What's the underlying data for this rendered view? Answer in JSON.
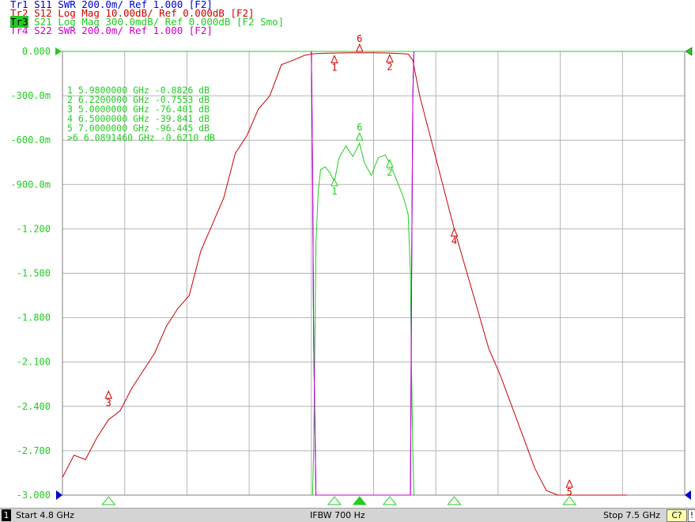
{
  "traces": [
    {
      "id": "tr1",
      "name": "Tr1",
      "param": "S11",
      "format": "SWR",
      "scale": "200.0m/",
      "ref": "Ref 1.000",
      "extra": "[F2]",
      "text": "S11 SWR 200.0m/ Ref 1.000 [F2]",
      "color": "#0000cc"
    },
    {
      "id": "tr2",
      "name": "Tr2",
      "param": "S12",
      "format": "Log Mag",
      "scale": "10.00dB/",
      "ref": "Ref 0.000dB",
      "extra": "[F2]",
      "text": "S12 Log Mag 10.00dB/ Ref 0.000dB [F2]",
      "color": "#cc0000"
    },
    {
      "id": "tr3",
      "name": "Tr3",
      "param": "S21",
      "format": "Log Mag",
      "scale": "300.0mdB/",
      "ref": "Ref 0.000dB",
      "extra": "[F2 Smo]",
      "text": "S21 Log Mag 300.0mdB/ Ref 0.000dB [F2 Smo]",
      "color": "#22cc22",
      "active": true
    },
    {
      "id": "tr4",
      "name": "Tr4",
      "param": "S22",
      "format": "SWR",
      "scale": "200.0m/",
      "ref": "Ref 1.000",
      "extra": "[F2]",
      "text": "S22 SWR 200.0m/ Ref 1.000 [F2]",
      "color": "#cc00cc"
    }
  ],
  "colors": {
    "tr1": "#0000cc",
    "tr2": "#cc0000",
    "tr3": "#22cc22",
    "tr4": "#cc00cc",
    "grid": "#b4b4b4",
    "ref_marker": "#22cc22"
  },
  "y_ticks": [
    "0.000",
    "-300.0m",
    "-600.0m",
    "-900.0m",
    "-1.200",
    "-1.500",
    "-1.800",
    "-2.100",
    "-2.400",
    "-2.700",
    "-3.000"
  ],
  "marker_table": [
    {
      "id": "1",
      "prefix": " ",
      "freq": "5.9800000 GHz",
      "value": "-0.8826 dB"
    },
    {
      "id": "2",
      "prefix": " ",
      "freq": "6.2200000 GHz",
      "value": "-0.7553 dB"
    },
    {
      "id": "3",
      "prefix": " ",
      "freq": "5.0000000 GHz",
      "value": "-76.401 dB"
    },
    {
      "id": "4",
      "prefix": " ",
      "freq": "6.5000000 GHz",
      "value": "-39.841 dB"
    },
    {
      "id": "5",
      "prefix": " ",
      "freq": "7.0000000 GHz",
      "value": "-96.445 dB"
    },
    {
      "id": "6",
      "prefix": ">",
      "freq": "6.0891460 GHz",
      "value": "-0.6210 dB"
    }
  ],
  "status": {
    "channel": "1",
    "start": "Start 4.8 GHz",
    "ifbw": "IFBW 700 Hz",
    "stop": "Stop 7.5 GHz",
    "cal": "C?",
    "warn": "!"
  },
  "chart_data": {
    "type": "line",
    "x_unit": "GHz",
    "xlim": [
      4.8,
      7.5
    ],
    "ylim_display": [
      -3.0,
      0.0
    ],
    "grid": true,
    "series": [
      {
        "trace": "tr3",
        "param": "S21",
        "unit": "dB",
        "x": [
          5.885,
          5.89,
          5.895,
          5.9,
          5.91,
          5.92,
          5.94,
          5.96,
          5.98,
          6.0,
          6.03,
          6.06,
          6.089,
          6.11,
          6.14,
          6.17,
          6.2,
          6.22,
          6.25,
          6.28,
          6.3,
          6.31,
          6.315,
          6.32,
          6.325
        ],
        "y": [
          -3.0,
          -2.7,
          -2.0,
          -1.3,
          -0.95,
          -0.8,
          -0.78,
          -0.82,
          -0.88,
          -0.72,
          -0.64,
          -0.71,
          -0.621,
          -0.75,
          -0.84,
          -0.72,
          -0.7,
          -0.755,
          -0.87,
          -0.99,
          -1.1,
          -1.5,
          -2.2,
          -2.7,
          -3.0
        ]
      },
      {
        "trace": "tr2",
        "param": "S12",
        "unit": "dB",
        "x": [
          4.8,
          4.85,
          4.9,
          4.95,
          5.0,
          5.05,
          5.1,
          5.15,
          5.2,
          5.25,
          5.3,
          5.35,
          5.4,
          5.45,
          5.5,
          5.55,
          5.6,
          5.65,
          5.7,
          5.75,
          5.8,
          5.85,
          5.88,
          5.9,
          5.95,
          6.0,
          6.05,
          6.1,
          6.15,
          6.2,
          6.25,
          6.3,
          6.32,
          6.35,
          6.4,
          6.45,
          6.5,
          6.55,
          6.6,
          6.65,
          6.7,
          6.75,
          6.8,
          6.85,
          6.9,
          6.95,
          7.0,
          7.02,
          7.05,
          7.1,
          7.15,
          7.2,
          7.25
        ],
        "y": [
          -96,
          -91,
          -92,
          -87,
          -83,
          -81,
          -76,
          -72,
          -68,
          -62,
          -58,
          -55,
          -45,
          -39,
          -33,
          -23,
          -19,
          -13,
          -10,
          -3,
          -2,
          -0.9,
          -0.6,
          -0.5,
          -0.4,
          -0.35,
          -0.3,
          -0.3,
          -0.3,
          -0.35,
          -0.45,
          -0.6,
          -2,
          -10,
          -20,
          -30,
          -40,
          -49,
          -58,
          -67,
          -73,
          -80,
          -87,
          -94,
          -99,
          -102,
          -108,
          -112,
          -117,
          -121,
          -117,
          -118,
          -118
        ]
      },
      {
        "trace": "tr1",
        "param": "S11",
        "unit": "SWR",
        "x": [
          5.88,
          5.885,
          5.89,
          5.9,
          5.91,
          5.92,
          5.93,
          5.95,
          5.97,
          5.98,
          6.0,
          6.03,
          6.06,
          6.08,
          6.1,
          6.13,
          6.15,
          6.18,
          6.2,
          6.22,
          6.24,
          6.26,
          6.28,
          6.3,
          6.305,
          6.31,
          6.315,
          6.32,
          6.325
        ],
        "y": [
          1.0,
          1.5,
          2.3,
          3.4,
          3.85,
          3.6,
          3.8,
          4.3,
          4.15,
          3.8,
          3.67,
          3.65,
          3.64,
          3.68,
          3.8,
          3.95,
          3.82,
          3.65,
          3.63,
          3.62,
          3.7,
          3.8,
          3.92,
          3.7,
          3.8,
          3.0,
          2.0,
          1.2,
          1.0
        ]
      },
      {
        "trace": "tr4",
        "param": "S22",
        "unit": "SWR",
        "x": [
          5.88,
          5.885,
          5.89,
          5.9,
          5.91,
          5.92,
          5.93,
          5.95,
          5.97,
          5.98,
          6.0,
          6.03,
          6.06,
          6.08,
          6.1,
          6.13,
          6.15,
          6.18,
          6.2,
          6.22,
          6.24,
          6.26,
          6.28,
          6.3,
          6.305,
          6.31,
          6.315,
          6.32,
          6.325
        ],
        "y": [
          1.0,
          1.5,
          2.3,
          3.4,
          3.9,
          3.62,
          3.78,
          4.3,
          4.2,
          3.85,
          3.7,
          3.64,
          3.62,
          3.66,
          3.82,
          3.98,
          3.85,
          3.65,
          3.64,
          3.64,
          3.72,
          3.85,
          3.95,
          3.9,
          3.7,
          3.0,
          2.0,
          1.2,
          1.0
        ]
      }
    ],
    "markers": [
      {
        "id": "1",
        "x": 5.98,
        "tr3_y": -0.8826,
        "tr2_y": -0.8
      },
      {
        "id": "2",
        "x": 6.22,
        "tr3_y": -0.7553,
        "tr2_y": -0.6
      },
      {
        "id": "3",
        "x": 5.0,
        "tr2_y": -76.401
      },
      {
        "id": "4",
        "x": 6.5,
        "tr2_y": -39.841
      },
      {
        "id": "5",
        "x": 7.0,
        "tr2_y": -96.445
      },
      {
        "id": "6",
        "x": 6.089146,
        "tr3_y": -0.621,
        "tr2_y": -0.3
      }
    ]
  }
}
